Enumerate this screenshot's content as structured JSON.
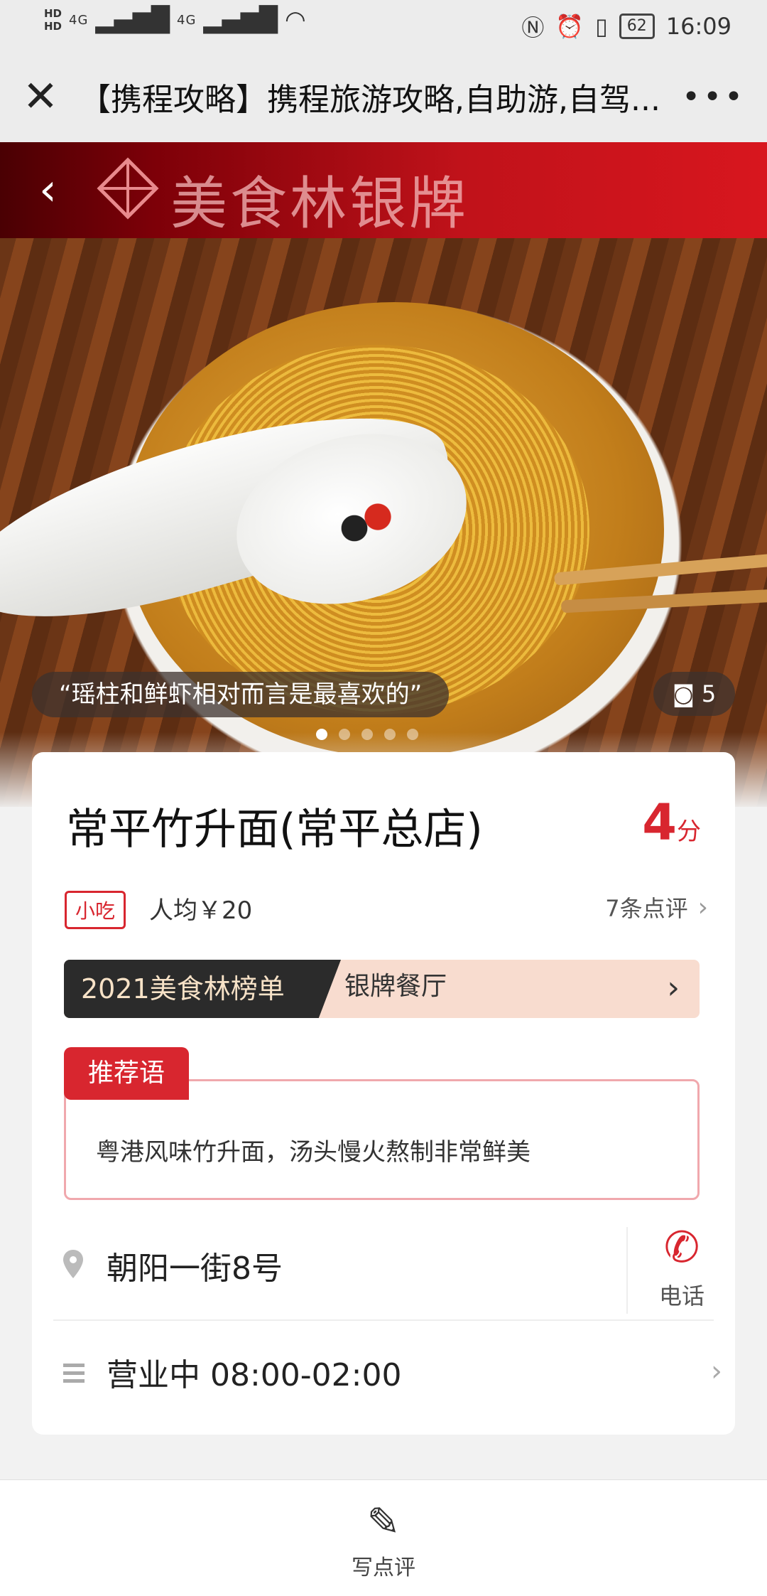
{
  "status_bar": {
    "time": "16:09",
    "battery": "62",
    "hd1": "HD",
    "hd2": "HD",
    "signal1": "4G",
    "signal2": "4G"
  },
  "topbar": {
    "title": "【携程攻略】携程旅游攻略,自助游,自驾...",
    "more": "•••"
  },
  "banner": {
    "text": "美食林银牌"
  },
  "photo": {
    "quote": "“瑶柱和鲜虾相对而言是最喜欢的”",
    "photo_count": "5"
  },
  "shop": {
    "name": "常平竹升面(常平总店)",
    "score": "4",
    "score_unit": "分",
    "tag": "小吃",
    "avg_price": "人均￥20",
    "reviews": "7条点评",
    "rank_title": "2021美食林榜单",
    "rank_level": "银牌餐厅",
    "recommend_label": "推荐语",
    "recommend_text": "粤港风味竹升面，汤头慢火熬制非常鲜美",
    "address": "朝阳一街8号",
    "phone_label": "电话",
    "hours": "营业中 08:00-02:00"
  },
  "bottom": {
    "write_review": "写点评"
  },
  "colors": {
    "accent": "#d8262f",
    "banner": "#c0121a",
    "rank_dark": "#2b2b2b",
    "rank_light": "#f8dccf"
  }
}
